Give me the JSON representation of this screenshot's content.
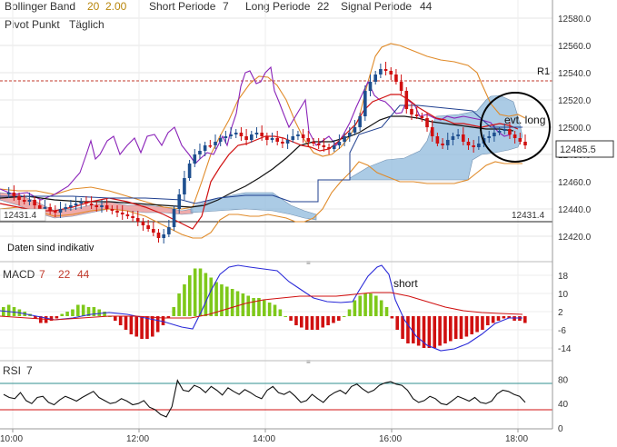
{
  "header": {
    "bollinger_label": "Bollinger Band",
    "bollinger_period": "20",
    "bollinger_dev": "2.00",
    "short_label": "Short Periode",
    "short_value": "7",
    "long_label": "Long Periode",
    "long_value": "22",
    "signal_label": "Signal Periode",
    "signal_value": "44",
    "pivot_label": "Pivot Punkt",
    "pivot_mode": "Täglich"
  },
  "main_panel": {
    "y_ticks": [
      "12580.0",
      "12560.0",
      "12540.0",
      "12520.0",
      "12500.0",
      "12480.0",
      "12460.0",
      "12440.0",
      "12420.0"
    ],
    "r1_label": "R1",
    "left_price_label": "12431.4",
    "right_price_label": "12431.4",
    "last_price_label": "12485.5",
    "disclaimer": "Daten sind indikativ",
    "annotation": "evt. long"
  },
  "macd_panel": {
    "label": "MACD",
    "p1": "7",
    "p2": "22",
    "p3": "44",
    "y_ticks": [
      "18",
      "10",
      "2",
      "-6",
      "-14"
    ],
    "annotation": "short"
  },
  "rsi_panel": {
    "label": "RSI",
    "period": "7",
    "y_ticks": [
      "80",
      "40",
      "0"
    ]
  },
  "x_axis": {
    "ticks": [
      "10:00",
      "12:00",
      "14:00",
      "16:00",
      "18:00"
    ]
  },
  "colors": {
    "up": "#1e4f8f",
    "down": "#d01010",
    "bollinger": "#e08a28",
    "fast_ma": "#d01010",
    "slow_ma": "#111111",
    "momentum": "#8a22b8",
    "cloud_fill": "#8fb9dc",
    "macd_pos": "#7ec81a",
    "macd_neg": "#d01010",
    "macd_line": "#2a2ad8",
    "signal_line": "#d01010",
    "pivot_line": "#c0392b",
    "rsi_line": "#111111",
    "rsi_band": "#2f8f8f"
  },
  "chart_data": {
    "type": "candlestick",
    "ylim": [
      12410,
      12590
    ],
    "r1_level": 12536,
    "pivot_level": 12431.4,
    "last_price": 12485.5,
    "x_ticks": [
      "10:00",
      "12:00",
      "14:00",
      "16:00",
      "18:00"
    ],
    "macd": {
      "ylim": [
        -18,
        22
      ],
      "histogram": [
        4,
        5,
        4,
        3,
        2,
        1,
        -1,
        -3,
        -3,
        -2,
        -1,
        1,
        2,
        3,
        5,
        5,
        4,
        4,
        3,
        2,
        0,
        -2,
        -4,
        -6,
        -8,
        -9,
        -10,
        -10,
        -9,
        -7,
        -4,
        -1,
        4,
        10,
        14,
        18,
        21,
        21,
        19,
        17,
        15,
        14,
        13,
        12,
        11,
        10,
        9,
        8,
        8,
        7,
        6,
        5,
        3,
        0,
        -2,
        -4,
        -5,
        -6,
        -6,
        -6,
        -5,
        -4,
        -3,
        -2,
        0,
        3,
        7,
        9,
        10,
        10,
        9,
        7,
        4,
        -1,
        -6,
        -10,
        -12,
        -12,
        -13,
        -14,
        -14,
        -14,
        -13,
        -12,
        -11,
        -10,
        -10,
        -9,
        -8,
        -7,
        -6,
        -4,
        -3,
        -2,
        -1,
        -1,
        -2,
        -2,
        -3
      ]
    },
    "rsi": {
      "ylim": [
        0,
        100
      ],
      "levels": [
        70,
        30
      ],
      "values": [
        55,
        50,
        48,
        58,
        45,
        40,
        50,
        52,
        42,
        38,
        46,
        52,
        48,
        44,
        50,
        55,
        60,
        50,
        45,
        40,
        42,
        48,
        44,
        38,
        40,
        45,
        34,
        30,
        22,
        18,
        35,
        78,
        62,
        60,
        70,
        66,
        58,
        68,
        62,
        54,
        66,
        60,
        55,
        63,
        58,
        52,
        48,
        62,
        68,
        58,
        55,
        60,
        52,
        42,
        45,
        55,
        48,
        42,
        52,
        58,
        62,
        56,
        68,
        72,
        64,
        58,
        62,
        70,
        74,
        76,
        72,
        70,
        62,
        48,
        42,
        45,
        52,
        48,
        40,
        38,
        45,
        52,
        48,
        44,
        50,
        42,
        40,
        44,
        56,
        62,
        60,
        55,
        52,
        42
      ]
    }
  }
}
